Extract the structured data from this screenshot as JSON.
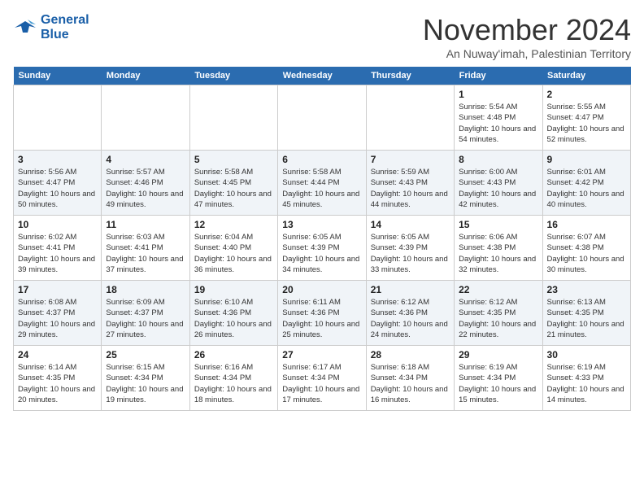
{
  "header": {
    "logo_line1": "General",
    "logo_line2": "Blue",
    "month": "November 2024",
    "location": "An Nuway'imah, Palestinian Territory"
  },
  "weekdays": [
    "Sunday",
    "Monday",
    "Tuesday",
    "Wednesday",
    "Thursday",
    "Friday",
    "Saturday"
  ],
  "weeks": [
    [
      {
        "day": "",
        "text": ""
      },
      {
        "day": "",
        "text": ""
      },
      {
        "day": "",
        "text": ""
      },
      {
        "day": "",
        "text": ""
      },
      {
        "day": "",
        "text": ""
      },
      {
        "day": "1",
        "text": "Sunrise: 5:54 AM\nSunset: 4:48 PM\nDaylight: 10 hours and 54 minutes."
      },
      {
        "day": "2",
        "text": "Sunrise: 5:55 AM\nSunset: 4:47 PM\nDaylight: 10 hours and 52 minutes."
      }
    ],
    [
      {
        "day": "3",
        "text": "Sunrise: 5:56 AM\nSunset: 4:47 PM\nDaylight: 10 hours and 50 minutes."
      },
      {
        "day": "4",
        "text": "Sunrise: 5:57 AM\nSunset: 4:46 PM\nDaylight: 10 hours and 49 minutes."
      },
      {
        "day": "5",
        "text": "Sunrise: 5:58 AM\nSunset: 4:45 PM\nDaylight: 10 hours and 47 minutes."
      },
      {
        "day": "6",
        "text": "Sunrise: 5:58 AM\nSunset: 4:44 PM\nDaylight: 10 hours and 45 minutes."
      },
      {
        "day": "7",
        "text": "Sunrise: 5:59 AM\nSunset: 4:43 PM\nDaylight: 10 hours and 44 minutes."
      },
      {
        "day": "8",
        "text": "Sunrise: 6:00 AM\nSunset: 4:43 PM\nDaylight: 10 hours and 42 minutes."
      },
      {
        "day": "9",
        "text": "Sunrise: 6:01 AM\nSunset: 4:42 PM\nDaylight: 10 hours and 40 minutes."
      }
    ],
    [
      {
        "day": "10",
        "text": "Sunrise: 6:02 AM\nSunset: 4:41 PM\nDaylight: 10 hours and 39 minutes."
      },
      {
        "day": "11",
        "text": "Sunrise: 6:03 AM\nSunset: 4:41 PM\nDaylight: 10 hours and 37 minutes."
      },
      {
        "day": "12",
        "text": "Sunrise: 6:04 AM\nSunset: 4:40 PM\nDaylight: 10 hours and 36 minutes."
      },
      {
        "day": "13",
        "text": "Sunrise: 6:05 AM\nSunset: 4:39 PM\nDaylight: 10 hours and 34 minutes."
      },
      {
        "day": "14",
        "text": "Sunrise: 6:05 AM\nSunset: 4:39 PM\nDaylight: 10 hours and 33 minutes."
      },
      {
        "day": "15",
        "text": "Sunrise: 6:06 AM\nSunset: 4:38 PM\nDaylight: 10 hours and 32 minutes."
      },
      {
        "day": "16",
        "text": "Sunrise: 6:07 AM\nSunset: 4:38 PM\nDaylight: 10 hours and 30 minutes."
      }
    ],
    [
      {
        "day": "17",
        "text": "Sunrise: 6:08 AM\nSunset: 4:37 PM\nDaylight: 10 hours and 29 minutes."
      },
      {
        "day": "18",
        "text": "Sunrise: 6:09 AM\nSunset: 4:37 PM\nDaylight: 10 hours and 27 minutes."
      },
      {
        "day": "19",
        "text": "Sunrise: 6:10 AM\nSunset: 4:36 PM\nDaylight: 10 hours and 26 minutes."
      },
      {
        "day": "20",
        "text": "Sunrise: 6:11 AM\nSunset: 4:36 PM\nDaylight: 10 hours and 25 minutes."
      },
      {
        "day": "21",
        "text": "Sunrise: 6:12 AM\nSunset: 4:36 PM\nDaylight: 10 hours and 24 minutes."
      },
      {
        "day": "22",
        "text": "Sunrise: 6:12 AM\nSunset: 4:35 PM\nDaylight: 10 hours and 22 minutes."
      },
      {
        "day": "23",
        "text": "Sunrise: 6:13 AM\nSunset: 4:35 PM\nDaylight: 10 hours and 21 minutes."
      }
    ],
    [
      {
        "day": "24",
        "text": "Sunrise: 6:14 AM\nSunset: 4:35 PM\nDaylight: 10 hours and 20 minutes."
      },
      {
        "day": "25",
        "text": "Sunrise: 6:15 AM\nSunset: 4:34 PM\nDaylight: 10 hours and 19 minutes."
      },
      {
        "day": "26",
        "text": "Sunrise: 6:16 AM\nSunset: 4:34 PM\nDaylight: 10 hours and 18 minutes."
      },
      {
        "day": "27",
        "text": "Sunrise: 6:17 AM\nSunset: 4:34 PM\nDaylight: 10 hours and 17 minutes."
      },
      {
        "day": "28",
        "text": "Sunrise: 6:18 AM\nSunset: 4:34 PM\nDaylight: 10 hours and 16 minutes."
      },
      {
        "day": "29",
        "text": "Sunrise: 6:19 AM\nSunset: 4:34 PM\nDaylight: 10 hours and 15 minutes."
      },
      {
        "day": "30",
        "text": "Sunrise: 6:19 AM\nSunset: 4:33 PM\nDaylight: 10 hours and 14 minutes."
      }
    ]
  ]
}
